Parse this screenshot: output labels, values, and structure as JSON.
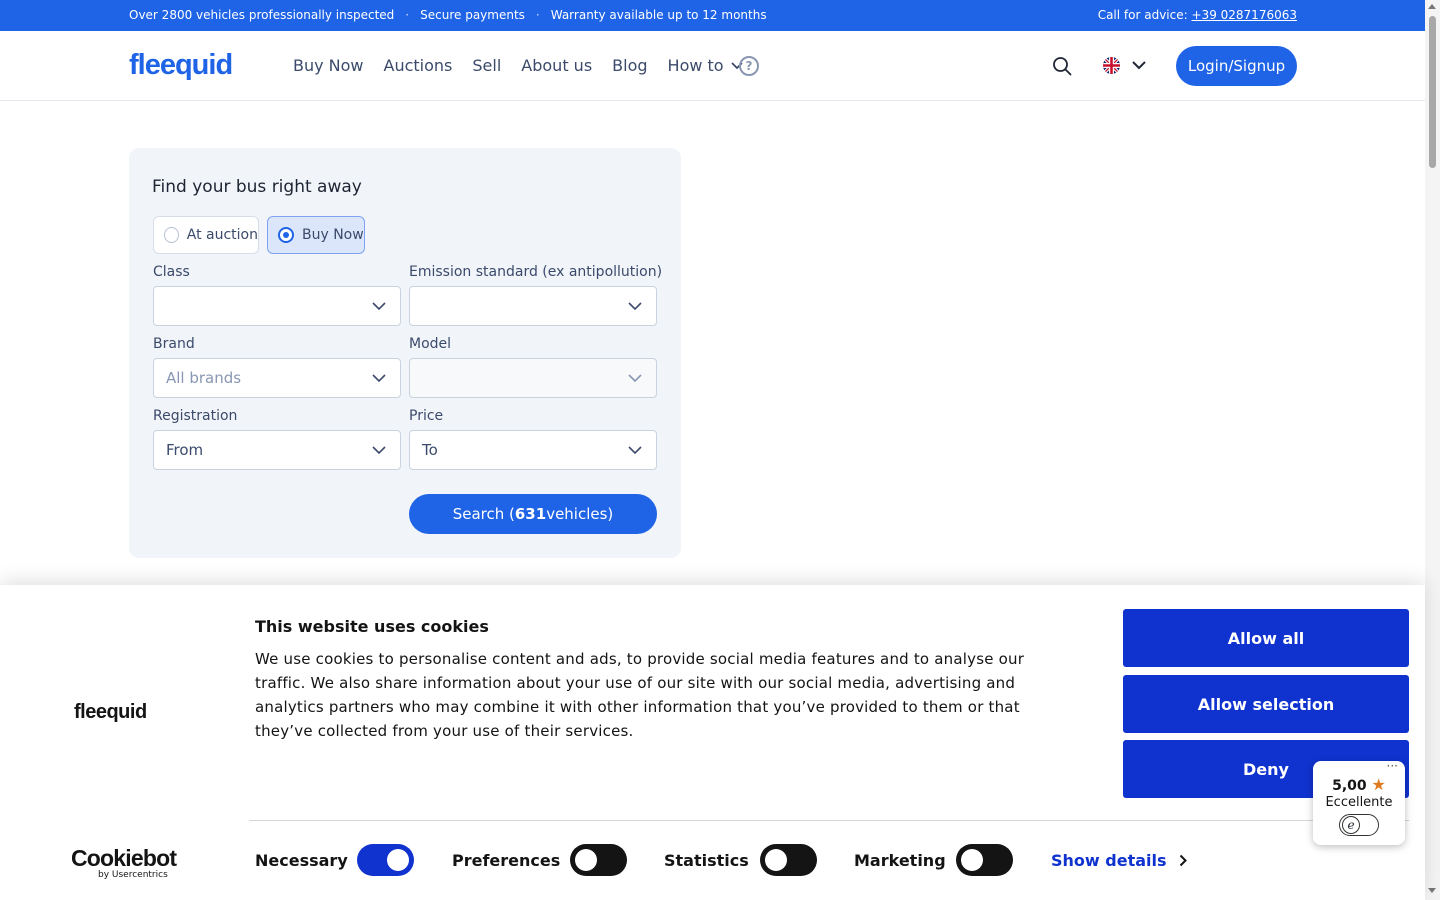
{
  "topbar": {
    "items": [
      "Over 2800 vehicles professionally inspected",
      "Secure payments",
      "Warranty available up to 12 months"
    ],
    "separator": "·",
    "advice_label": "Call for advice:",
    "phone": "+39 0287176063"
  },
  "header": {
    "logo": "fleequid",
    "nav": [
      "Buy Now",
      "Auctions",
      "Sell",
      "About us",
      "Blog",
      "How to"
    ],
    "help_glyph": "?",
    "login_label": "Login/Signup"
  },
  "search": {
    "title": "Find your bus right away",
    "modes": [
      "At auction",
      "Buy Now"
    ],
    "selected_mode": "Buy Now",
    "fields": {
      "class_label": "Class",
      "class_value": "",
      "emission_label": "Emission standard (ex antipollution)",
      "emission_value": "",
      "brand_label": "Brand",
      "brand_placeholder": "All brands",
      "model_label": "Model",
      "model_value": "",
      "registration_label": "Registration",
      "registration_value": "From",
      "price_label": "Price",
      "price_value": "To"
    },
    "button_prefix": "Search (",
    "button_count": "631",
    "button_suffix": " vehicles)"
  },
  "cookie": {
    "logo": "fleequid",
    "title": "This website uses cookies",
    "text": "We use cookies to personalise content and ads, to provide social media features and to analyse our traffic. We also share information about your use of our site with our social media, advertising and analytics partners who may combine it with other information that you’ve provided to them or that they’ve collected from your use of their services.",
    "buttons": [
      "Allow all",
      "Allow selection",
      "Deny"
    ],
    "toggles": [
      {
        "label": "Necessary",
        "on": true
      },
      {
        "label": "Preferences",
        "on": false
      },
      {
        "label": "Statistics",
        "on": false
      },
      {
        "label": "Marketing",
        "on": false
      }
    ],
    "show_details": "Show details",
    "cookiebot_name": "Cookiebot",
    "cookiebot_sub": "by Usercentrics"
  },
  "rating": {
    "more": "···",
    "score": "5,00",
    "star": "★",
    "label": "Eccellente",
    "badge": "e"
  },
  "colors": {
    "brand": "#1f63e6",
    "cookie_accent": "#1032cf"
  }
}
